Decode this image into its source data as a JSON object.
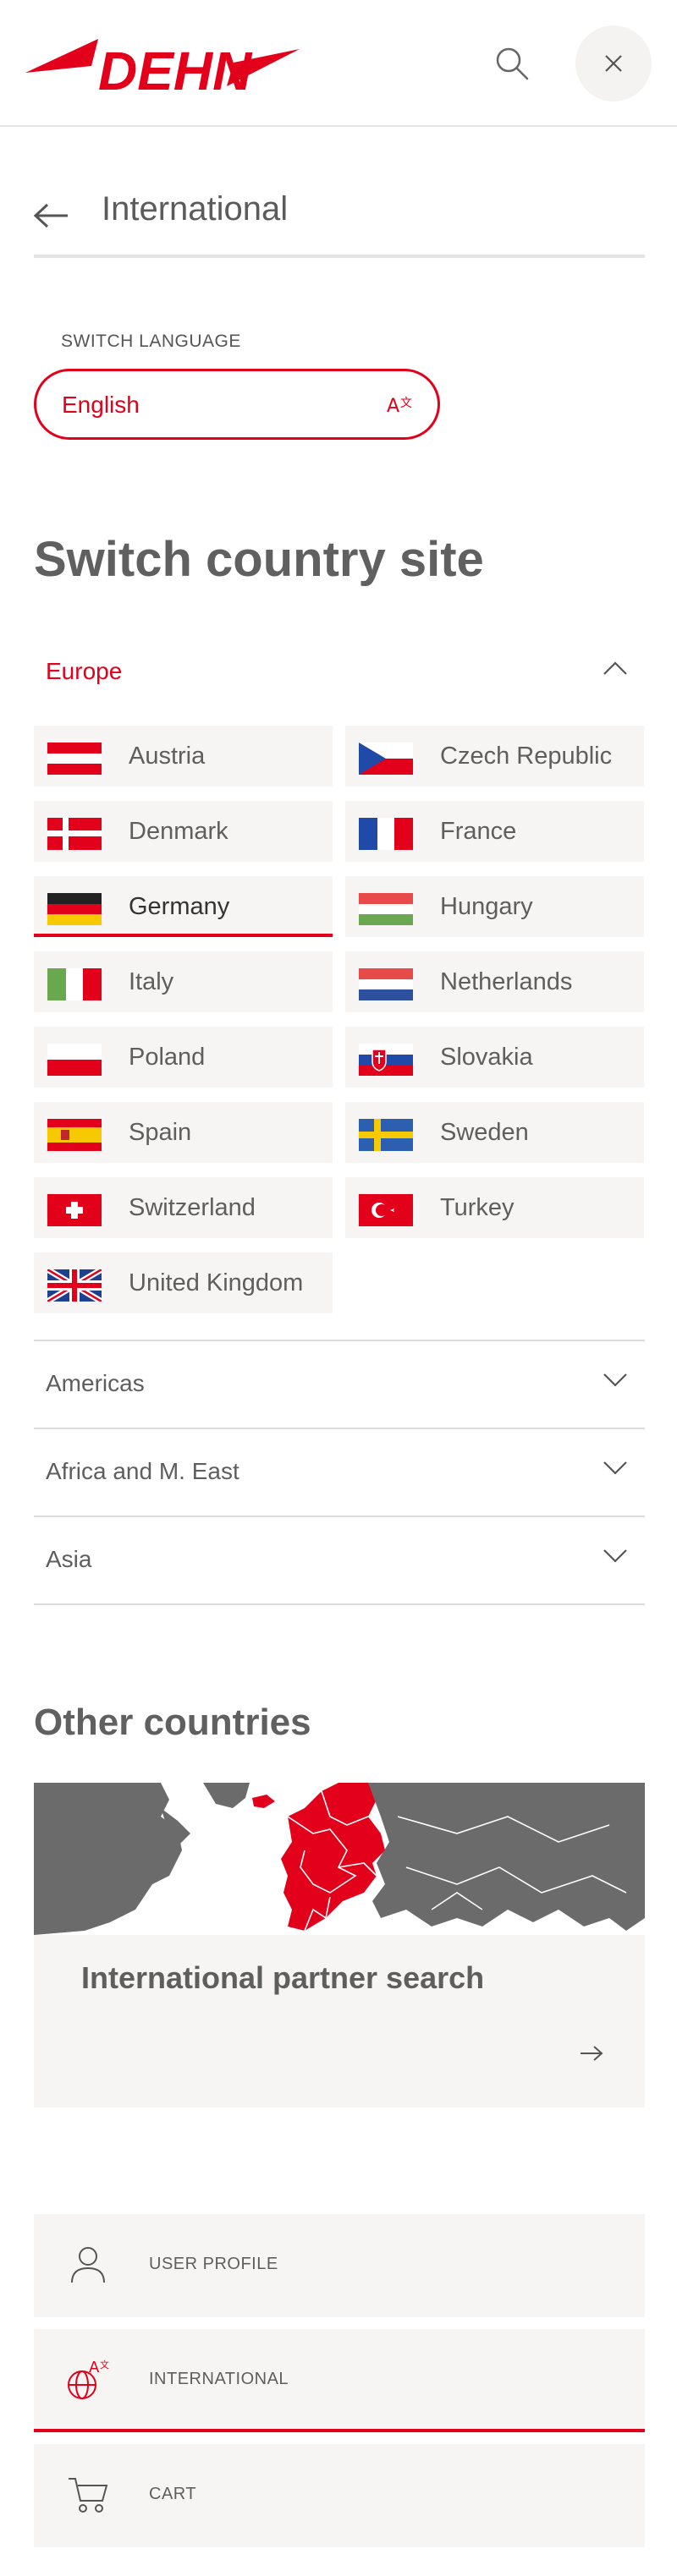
{
  "header": {
    "logo_text": "DEHN",
    "search_icon": "search-icon",
    "close_icon": "close-icon"
  },
  "subheader": {
    "back_icon": "arrow-left-icon",
    "title": "International"
  },
  "language": {
    "label": "SWITCH LANGUAGE",
    "value": "English",
    "icon": "translate-icon"
  },
  "switch_country": {
    "title": "Switch country site",
    "regions": [
      {
        "label": "Europe",
        "expanded": true,
        "countries": [
          {
            "name": "Austria",
            "flag": "austria-flag"
          },
          {
            "name": "Czech Republic",
            "flag": "czech-flag"
          },
          {
            "name": "Denmark",
            "flag": "denmark-flag"
          },
          {
            "name": "France",
            "flag": "france-flag"
          },
          {
            "name": "Germany",
            "flag": "germany-flag",
            "active": true
          },
          {
            "name": "Hungary",
            "flag": "hungary-flag"
          },
          {
            "name": "Italy",
            "flag": "italy-flag"
          },
          {
            "name": "Netherlands",
            "flag": "netherlands-flag"
          },
          {
            "name": "Poland",
            "flag": "poland-flag"
          },
          {
            "name": "Slovakia",
            "flag": "slovakia-flag"
          },
          {
            "name": "Spain",
            "flag": "spain-flag"
          },
          {
            "name": "Sweden",
            "flag": "sweden-flag"
          },
          {
            "name": "Switzerland",
            "flag": "switzerland-flag"
          },
          {
            "name": "Turkey",
            "flag": "turkey-flag"
          },
          {
            "name": "United Kingdom",
            "flag": "uk-flag"
          }
        ]
      },
      {
        "label": "Americas",
        "expanded": false
      },
      {
        "label": "Africa and M. East",
        "expanded": false
      },
      {
        "label": "Asia",
        "expanded": false
      }
    ]
  },
  "other_countries": {
    "title": "Other countries",
    "card_title": "International partner search",
    "card_icon": "arrow-right-icon"
  },
  "footer_nav": [
    {
      "label": "USER PROFILE",
      "icon": "user-icon"
    },
    {
      "label": "INTERNATIONAL",
      "icon": "globe-translate-icon",
      "active": true
    },
    {
      "label": "CART",
      "icon": "cart-icon"
    }
  ],
  "colors": {
    "accent": "#e2001a",
    "panel": "#f6f5f3",
    "text": "#5e5e5e"
  }
}
